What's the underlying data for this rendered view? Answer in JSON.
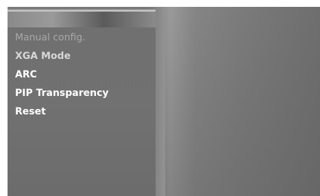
{
  "menu": {
    "items": [
      {
        "label": "Manual config.",
        "state": "disabled"
      },
      {
        "label": "XGA Mode",
        "state": "dim"
      },
      {
        "label": "ARC",
        "state": "normal"
      },
      {
        "label": "PIP Transparency",
        "state": "normal"
      },
      {
        "label": "Reset",
        "state": "normal"
      }
    ]
  },
  "colors": {
    "panel": "#6f6f6f",
    "text": "#ffffff",
    "text_disabled": "#a8a8a8"
  }
}
